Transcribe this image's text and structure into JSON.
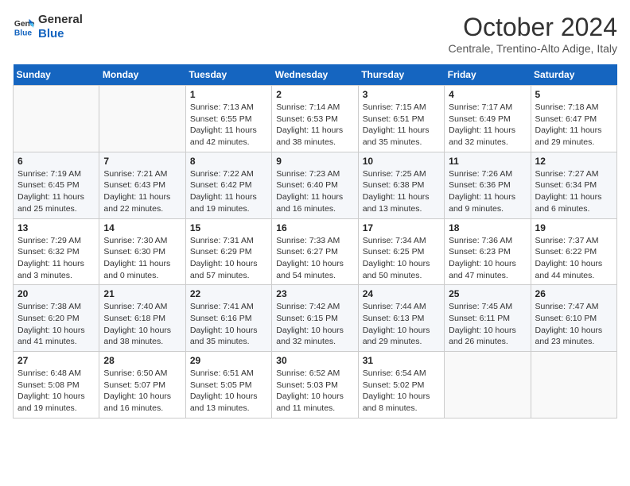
{
  "logo": {
    "line1": "General",
    "line2": "Blue"
  },
  "title": "October 2024",
  "location": "Centrale, Trentino-Alto Adige, Italy",
  "weekdays": [
    "Sunday",
    "Monday",
    "Tuesday",
    "Wednesday",
    "Thursday",
    "Friday",
    "Saturday"
  ],
  "weeks": [
    [
      {
        "day": "",
        "sunrise": "",
        "sunset": "",
        "daylight": ""
      },
      {
        "day": "",
        "sunrise": "",
        "sunset": "",
        "daylight": ""
      },
      {
        "day": "1",
        "sunrise": "Sunrise: 7:13 AM",
        "sunset": "Sunset: 6:55 PM",
        "daylight": "Daylight: 11 hours and 42 minutes."
      },
      {
        "day": "2",
        "sunrise": "Sunrise: 7:14 AM",
        "sunset": "Sunset: 6:53 PM",
        "daylight": "Daylight: 11 hours and 38 minutes."
      },
      {
        "day": "3",
        "sunrise": "Sunrise: 7:15 AM",
        "sunset": "Sunset: 6:51 PM",
        "daylight": "Daylight: 11 hours and 35 minutes."
      },
      {
        "day": "4",
        "sunrise": "Sunrise: 7:17 AM",
        "sunset": "Sunset: 6:49 PM",
        "daylight": "Daylight: 11 hours and 32 minutes."
      },
      {
        "day": "5",
        "sunrise": "Sunrise: 7:18 AM",
        "sunset": "Sunset: 6:47 PM",
        "daylight": "Daylight: 11 hours and 29 minutes."
      }
    ],
    [
      {
        "day": "6",
        "sunrise": "Sunrise: 7:19 AM",
        "sunset": "Sunset: 6:45 PM",
        "daylight": "Daylight: 11 hours and 25 minutes."
      },
      {
        "day": "7",
        "sunrise": "Sunrise: 7:21 AM",
        "sunset": "Sunset: 6:43 PM",
        "daylight": "Daylight: 11 hours and 22 minutes."
      },
      {
        "day": "8",
        "sunrise": "Sunrise: 7:22 AM",
        "sunset": "Sunset: 6:42 PM",
        "daylight": "Daylight: 11 hours and 19 minutes."
      },
      {
        "day": "9",
        "sunrise": "Sunrise: 7:23 AM",
        "sunset": "Sunset: 6:40 PM",
        "daylight": "Daylight: 11 hours and 16 minutes."
      },
      {
        "day": "10",
        "sunrise": "Sunrise: 7:25 AM",
        "sunset": "Sunset: 6:38 PM",
        "daylight": "Daylight: 11 hours and 13 minutes."
      },
      {
        "day": "11",
        "sunrise": "Sunrise: 7:26 AM",
        "sunset": "Sunset: 6:36 PM",
        "daylight": "Daylight: 11 hours and 9 minutes."
      },
      {
        "day": "12",
        "sunrise": "Sunrise: 7:27 AM",
        "sunset": "Sunset: 6:34 PM",
        "daylight": "Daylight: 11 hours and 6 minutes."
      }
    ],
    [
      {
        "day": "13",
        "sunrise": "Sunrise: 7:29 AM",
        "sunset": "Sunset: 6:32 PM",
        "daylight": "Daylight: 11 hours and 3 minutes."
      },
      {
        "day": "14",
        "sunrise": "Sunrise: 7:30 AM",
        "sunset": "Sunset: 6:30 PM",
        "daylight": "Daylight: 11 hours and 0 minutes."
      },
      {
        "day": "15",
        "sunrise": "Sunrise: 7:31 AM",
        "sunset": "Sunset: 6:29 PM",
        "daylight": "Daylight: 10 hours and 57 minutes."
      },
      {
        "day": "16",
        "sunrise": "Sunrise: 7:33 AM",
        "sunset": "Sunset: 6:27 PM",
        "daylight": "Daylight: 10 hours and 54 minutes."
      },
      {
        "day": "17",
        "sunrise": "Sunrise: 7:34 AM",
        "sunset": "Sunset: 6:25 PM",
        "daylight": "Daylight: 10 hours and 50 minutes."
      },
      {
        "day": "18",
        "sunrise": "Sunrise: 7:36 AM",
        "sunset": "Sunset: 6:23 PM",
        "daylight": "Daylight: 10 hours and 47 minutes."
      },
      {
        "day": "19",
        "sunrise": "Sunrise: 7:37 AM",
        "sunset": "Sunset: 6:22 PM",
        "daylight": "Daylight: 10 hours and 44 minutes."
      }
    ],
    [
      {
        "day": "20",
        "sunrise": "Sunrise: 7:38 AM",
        "sunset": "Sunset: 6:20 PM",
        "daylight": "Daylight: 10 hours and 41 minutes."
      },
      {
        "day": "21",
        "sunrise": "Sunrise: 7:40 AM",
        "sunset": "Sunset: 6:18 PM",
        "daylight": "Daylight: 10 hours and 38 minutes."
      },
      {
        "day": "22",
        "sunrise": "Sunrise: 7:41 AM",
        "sunset": "Sunset: 6:16 PM",
        "daylight": "Daylight: 10 hours and 35 minutes."
      },
      {
        "day": "23",
        "sunrise": "Sunrise: 7:42 AM",
        "sunset": "Sunset: 6:15 PM",
        "daylight": "Daylight: 10 hours and 32 minutes."
      },
      {
        "day": "24",
        "sunrise": "Sunrise: 7:44 AM",
        "sunset": "Sunset: 6:13 PM",
        "daylight": "Daylight: 10 hours and 29 minutes."
      },
      {
        "day": "25",
        "sunrise": "Sunrise: 7:45 AM",
        "sunset": "Sunset: 6:11 PM",
        "daylight": "Daylight: 10 hours and 26 minutes."
      },
      {
        "day": "26",
        "sunrise": "Sunrise: 7:47 AM",
        "sunset": "Sunset: 6:10 PM",
        "daylight": "Daylight: 10 hours and 23 minutes."
      }
    ],
    [
      {
        "day": "27",
        "sunrise": "Sunrise: 6:48 AM",
        "sunset": "Sunset: 5:08 PM",
        "daylight": "Daylight: 10 hours and 19 minutes."
      },
      {
        "day": "28",
        "sunrise": "Sunrise: 6:50 AM",
        "sunset": "Sunset: 5:07 PM",
        "daylight": "Daylight: 10 hours and 16 minutes."
      },
      {
        "day": "29",
        "sunrise": "Sunrise: 6:51 AM",
        "sunset": "Sunset: 5:05 PM",
        "daylight": "Daylight: 10 hours and 13 minutes."
      },
      {
        "day": "30",
        "sunrise": "Sunrise: 6:52 AM",
        "sunset": "Sunset: 5:03 PM",
        "daylight": "Daylight: 10 hours and 11 minutes."
      },
      {
        "day": "31",
        "sunrise": "Sunrise: 6:54 AM",
        "sunset": "Sunset: 5:02 PM",
        "daylight": "Daylight: 10 hours and 8 minutes."
      },
      {
        "day": "",
        "sunrise": "",
        "sunset": "",
        "daylight": ""
      },
      {
        "day": "",
        "sunrise": "",
        "sunset": "",
        "daylight": ""
      }
    ]
  ]
}
